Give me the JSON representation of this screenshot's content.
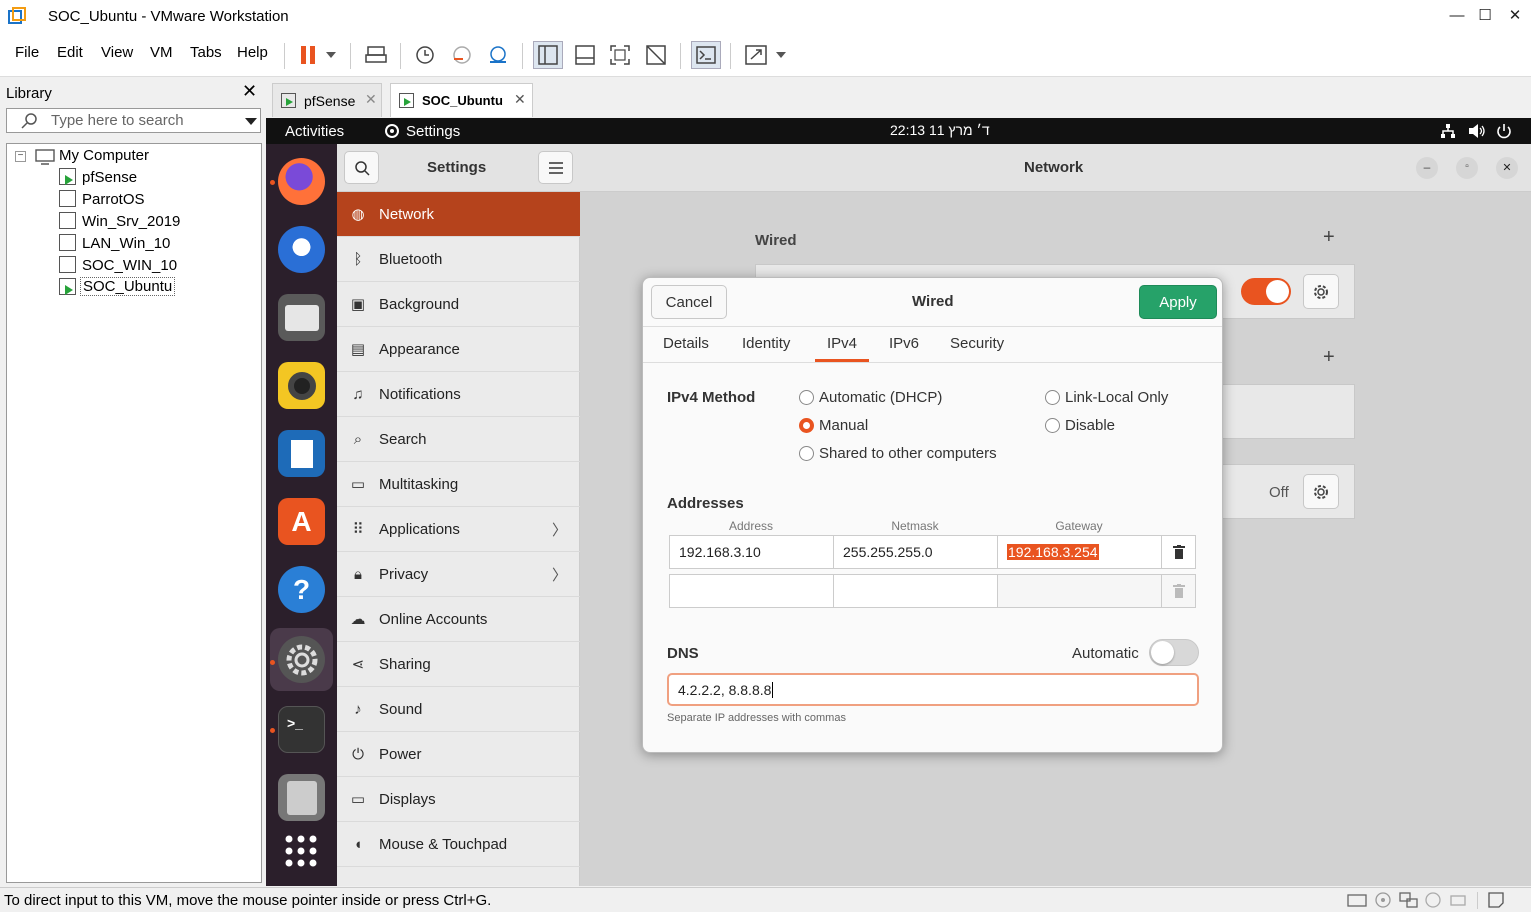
{
  "window": {
    "title": "SOC_Ubuntu - VMware Workstation",
    "min": "—",
    "max": "☐",
    "close": "✕"
  },
  "menu": [
    "File",
    "Edit",
    "View",
    "VM",
    "Tabs",
    "Help"
  ],
  "library": {
    "title": "Library",
    "search_placeholder": "Type here to search",
    "root": "My Computer",
    "items": [
      "pfSense",
      "ParrotOS",
      "Win_Srv_2019",
      "LAN_Win_10",
      "SOC_WIN_10",
      "SOC_Ubuntu"
    ]
  },
  "vm_tabs": [
    "pfSense",
    "SOC_Ubuntu"
  ],
  "guest_top": {
    "activities": "Activities",
    "app": "Settings",
    "clock": "ד׳ מרץ 11  22:13"
  },
  "settings": {
    "title": "Settings",
    "page_title": "Network",
    "sidebar": [
      {
        "label": "Network",
        "icon": "network-icon"
      },
      {
        "label": "Bluetooth",
        "icon": "bluetooth-icon"
      },
      {
        "label": "Background",
        "icon": "background-icon"
      },
      {
        "label": "Appearance",
        "icon": "appearance-icon"
      },
      {
        "label": "Notifications",
        "icon": "bell-icon"
      },
      {
        "label": "Search",
        "icon": "search-icon"
      },
      {
        "label": "Multitasking",
        "icon": "multitasking-icon"
      },
      {
        "label": "Applications",
        "icon": "apps-icon"
      },
      {
        "label": "Privacy",
        "icon": "lock-icon"
      },
      {
        "label": "Online Accounts",
        "icon": "cloud-icon"
      },
      {
        "label": "Sharing",
        "icon": "share-icon"
      },
      {
        "label": "Sound",
        "icon": "music-icon"
      },
      {
        "label": "Power",
        "icon": "power-icon"
      },
      {
        "label": "Displays",
        "icon": "display-icon"
      },
      {
        "label": "Mouse & Touchpad",
        "icon": "mouse-icon"
      }
    ],
    "wired_heading": "Wired",
    "vpn_off": "Off"
  },
  "dialog": {
    "cancel": "Cancel",
    "title": "Wired",
    "apply": "Apply",
    "tabs": [
      "Details",
      "Identity",
      "IPv4",
      "IPv6",
      "Security"
    ],
    "active_tab": "IPv4",
    "method_label": "IPv4 Method",
    "methods": {
      "auto": "Automatic (DHCP)",
      "manual": "Manual",
      "shared": "Shared to other computers",
      "linklocal": "Link-Local Only",
      "disable": "Disable"
    },
    "selected_method": "Manual",
    "addresses_label": "Addresses",
    "col_address": "Address",
    "col_netmask": "Netmask",
    "col_gateway": "Gateway",
    "row1": {
      "address": "192.168.3.10",
      "netmask": "255.255.255.0",
      "gateway": "192.168.3.254"
    },
    "dns_label": "DNS",
    "dns_automatic": "Automatic",
    "dns_value": "4.2.2.2, 8.8.8.8",
    "dns_hint": "Separate IP addresses with commas"
  },
  "status": {
    "text": "To direct input to this VM, move the mouse pointer inside or press Ctrl+G."
  },
  "colors": {
    "accent": "#e95420",
    "sidebar_selected": "#b5431c",
    "apply": "#26a269"
  }
}
